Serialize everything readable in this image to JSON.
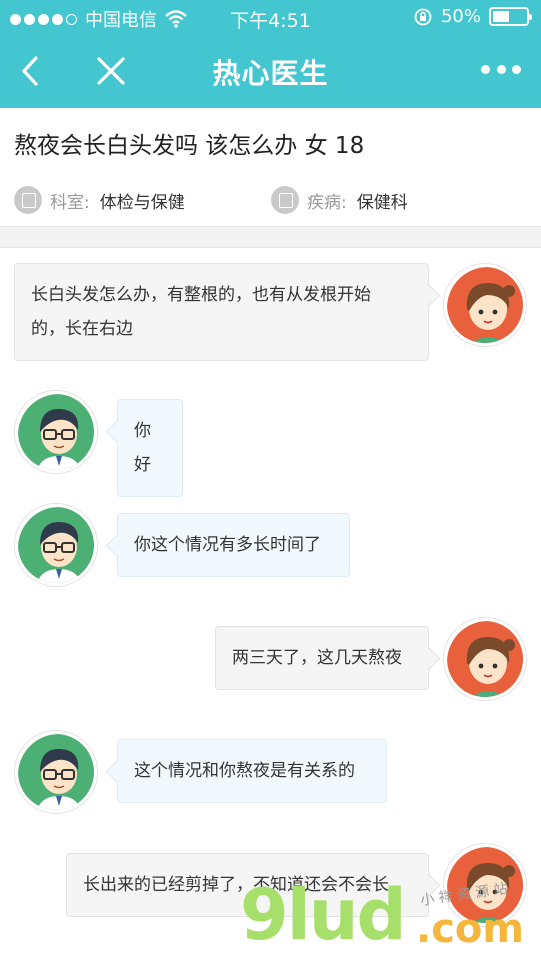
{
  "status_bar": {
    "carrier": "中国电信",
    "time": "下午4:51",
    "battery": "50%",
    "battery_level": 0.5
  },
  "nav": {
    "title": "热心医生",
    "back_icon": "chevron-left-icon",
    "close_icon": "close-icon",
    "more_icon": "more-icon"
  },
  "question": {
    "title": "熬夜会长白头发吗 该怎么办 女 18",
    "department_label": "科室:",
    "department_value": "体检与保健",
    "disease_label": "疾病:",
    "disease_value": "保健科"
  },
  "messages": [
    {
      "role": "user",
      "text_line1": "长白头发怎么办，有整根的，也有从发根开始",
      "text_line2": "的，长在右边"
    },
    {
      "role": "doctor",
      "text": "你好"
    },
    {
      "role": "doctor",
      "text": "你这个情况有多长时间了"
    },
    {
      "role": "user",
      "text": "两三天了，这几天熬夜"
    },
    {
      "role": "doctor",
      "text": "这个情况和你熬夜是有关系的"
    },
    {
      "role": "user",
      "text": "长出来的已经剪掉了，不知道还会不会长"
    }
  ],
  "watermark": {
    "big": "9lud",
    "com": ".com",
    "small": "小 祥 资 源 站"
  },
  "colors": {
    "header": "#43c6cf",
    "doctor_avatar_bg": "#4caf74",
    "user_avatar_bg": "#e8613c",
    "doctor_bubble": "#f1f9fe",
    "user_bubble": "#f5f5f5"
  }
}
